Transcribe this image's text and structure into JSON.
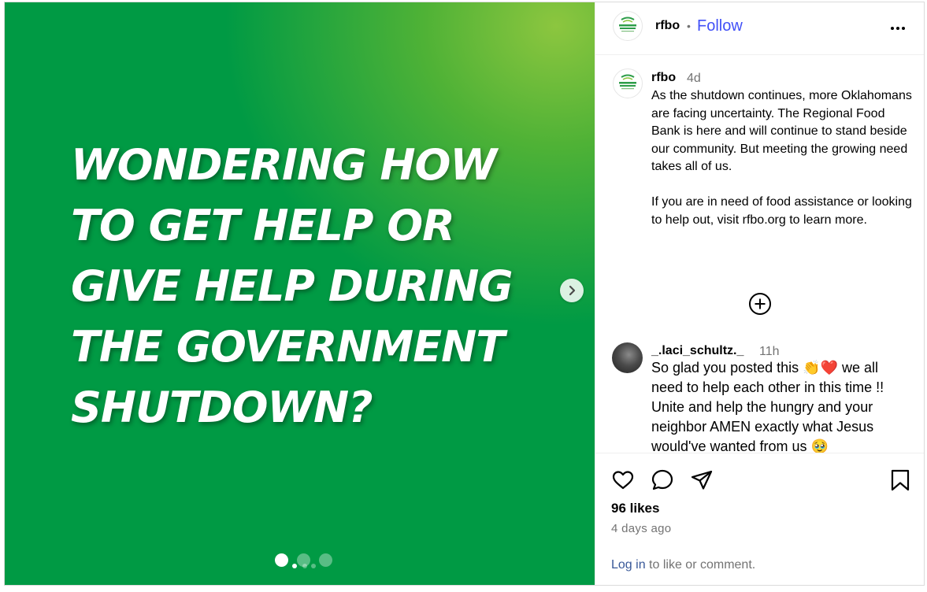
{
  "media": {
    "headline_lines": [
      "WONDERING HOW",
      "TO GET HELP OR",
      "GIVE HELP DURING",
      "THE GOVERNMENT",
      "SHUTDOWN?"
    ],
    "slide_count": 4,
    "active_slide": 1,
    "bg_color": "#009a44",
    "accent_color": "#8cc63f"
  },
  "header": {
    "username": "rfbo",
    "separator": "•",
    "follow_label": "Follow",
    "logo_text": [
      "REGIONAL",
      "FOOD BANK"
    ]
  },
  "caption": {
    "username": "rfbo",
    "time": "4d",
    "text": "As the shutdown continues, more Oklahomans are facing uncertainty. The Regional Food Bank is here and will continue to stand beside our community. But meeting the growing need takes all of us.\n\nIf you are in need of food assistance or looking to help out, visit rfbo.org to learn more."
  },
  "comment": {
    "username": "_.laci_schultz._",
    "time": "11h",
    "text": "So glad you posted this 👏❤️ we all need to help each other in this time !! Unite and help the hungry and your neighbor AMEN exactly what Jesus would've wanted from us 🥹"
  },
  "engagement": {
    "likes": "96 likes",
    "date": "4 days ago"
  },
  "login": {
    "link_label": "Log in",
    "rest": "to like or comment."
  },
  "colors": {
    "follow_blue": "#4150f7",
    "link_blue": "#385898",
    "muted": "#737373"
  }
}
